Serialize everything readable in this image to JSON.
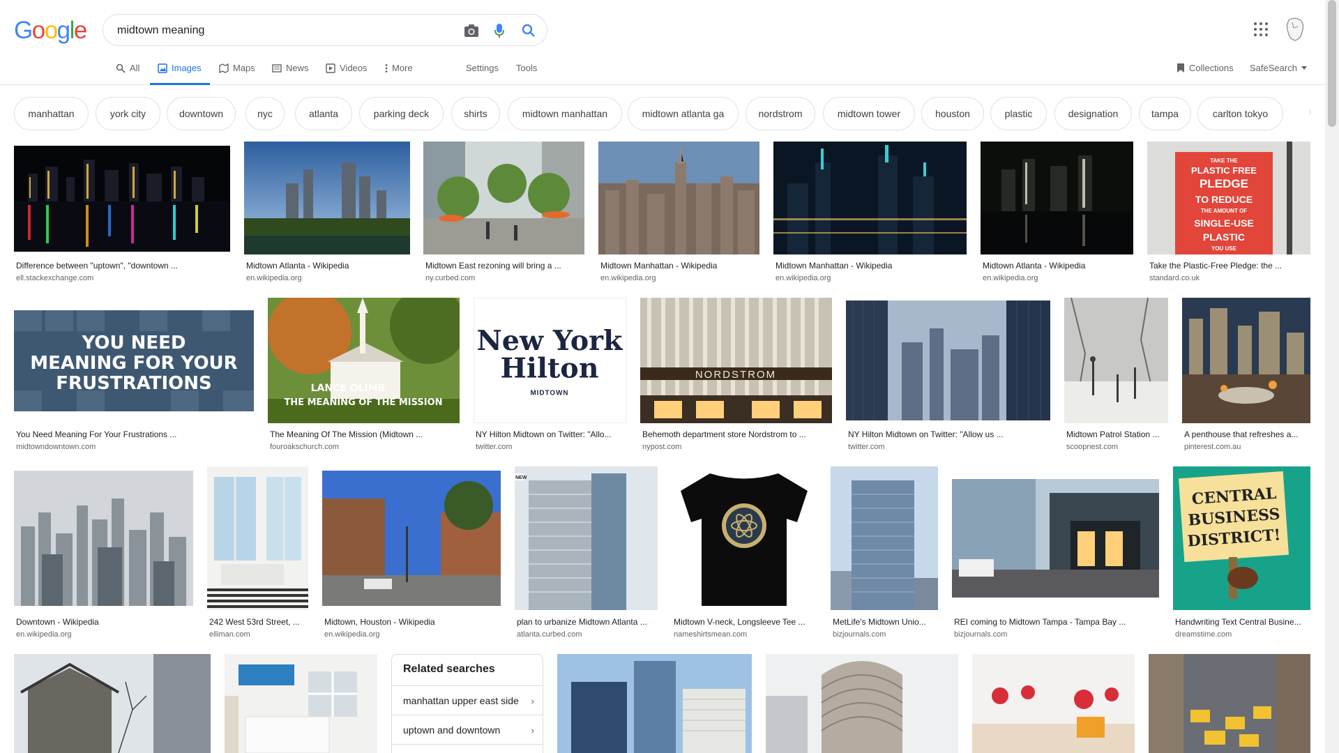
{
  "logo": {
    "letters": [
      "G",
      "o",
      "o",
      "g",
      "l",
      "e"
    ],
    "colors": [
      "#4285f4",
      "#ea4335",
      "#fbbc05",
      "#4285f4",
      "#34a853",
      "#ea4335"
    ]
  },
  "search": {
    "query": "midtown meaning"
  },
  "tabs": [
    {
      "label": "All",
      "icon": "search-icon"
    },
    {
      "label": "Images",
      "icon": "image-icon"
    },
    {
      "label": "Maps",
      "icon": "map-icon"
    },
    {
      "label": "News",
      "icon": "news-icon"
    },
    {
      "label": "Videos",
      "icon": "video-icon"
    },
    {
      "label": "More",
      "icon": "more-dots-icon"
    }
  ],
  "tools": {
    "settings": "Settings",
    "tools": "Tools",
    "collections": "Collections",
    "safesearch": "SafeSearch"
  },
  "chips": [
    "manhattan",
    "york city",
    "downtown",
    "nyc",
    "atlanta",
    "parking deck",
    "shirts",
    "midtown manhattan",
    "midtown atlanta ga",
    "nordstrom",
    "midtown tower",
    "houston",
    "plastic",
    "designation",
    "tampa",
    "carlton tokyo"
  ],
  "results": [
    {
      "title": "Difference between \"uptown\", \"downtown ...",
      "source": "ell.stackexchange.com"
    },
    {
      "title": "Midtown Atlanta - Wikipedia",
      "source": "en.wikipedia.org"
    },
    {
      "title": "Midtown East rezoning will bring a ...",
      "source": "ny.curbed.com"
    },
    {
      "title": "Midtown Manhattan - Wikipedia",
      "source": "en.wikipedia.org"
    },
    {
      "title": "Midtown Manhattan - Wikipedia",
      "source": "en.wikipedia.org"
    },
    {
      "title": "Midtown Atlanta - Wikipedia",
      "source": "en.wikipedia.org"
    },
    {
      "title": "Take the Plastic-Free Pledge: the ...",
      "source": "standard.co.uk"
    },
    {
      "title": "You Need Meaning For Your Frustrations ...",
      "source": "midtowndowntown.com"
    },
    {
      "title": "The Meaning Of The Mission (Midtown ...",
      "source": "fouroakschurch.com"
    },
    {
      "title": "NY Hilton Midtown on Twitter: \"Allo...",
      "source": "twitter.com"
    },
    {
      "title": "Behemoth department store Nordstrom to ...",
      "source": "nypost.com"
    },
    {
      "title": "NY Hilton Midtown on Twitter: \"Allow us ...",
      "source": "twitter.com"
    },
    {
      "title": "Midtown Patrol Station ...",
      "source": "scoopnest.com"
    },
    {
      "title": "A penthouse that refreshes a...",
      "source": "pinterest.com.au"
    },
    {
      "title": "Downtown - Wikipedia",
      "source": "en.wikipedia.org"
    },
    {
      "title": "242 West 53rd Street, ...",
      "source": "elliman.com"
    },
    {
      "title": "Midtown, Houston - Wikipedia",
      "source": "en.wikipedia.org"
    },
    {
      "title": "plan to urbanize Midtown Atlanta ...",
      "source": "atlanta.curbed.com"
    },
    {
      "title": "Midtown V-neck, Longsleeve Tee ...",
      "source": "nameshirtsmean.com"
    },
    {
      "title": "MetLife's Midtown Unio...",
      "source": "bizjournals.com"
    },
    {
      "title": "REI coming to Midtown Tampa - Tampa Bay ...",
      "source": "bizjournals.com"
    },
    {
      "title": "Handwriting Text Central Busine...",
      "source": "dreamstime.com"
    }
  ],
  "image_text": {
    "frustrations": [
      "YOU NEED",
      "MEANING FOR YOUR",
      "FRUSTRATIONS"
    ],
    "mission": [
      "LANCE OLIMB",
      "THE MEANING OF THE MISSION"
    ],
    "hilton": [
      "New York",
      "Hilton",
      "MIDTOWN"
    ],
    "nordstrom": "NORDSTROM",
    "pledge": [
      "TAKE THE",
      "PLASTIC FREE",
      "PLEDGE",
      "TO REDUCE",
      "THE AMOUNT OF",
      "SINGLE-USE",
      "PLASTIC",
      "YOU USE"
    ],
    "cbd": [
      "CENTRAL",
      "BUSINESS",
      "DISTRICT!"
    ],
    "new_tag": "NEW"
  },
  "related": {
    "title": "Related searches",
    "items": [
      "manhattan upper east side",
      "uptown and downtown"
    ]
  }
}
